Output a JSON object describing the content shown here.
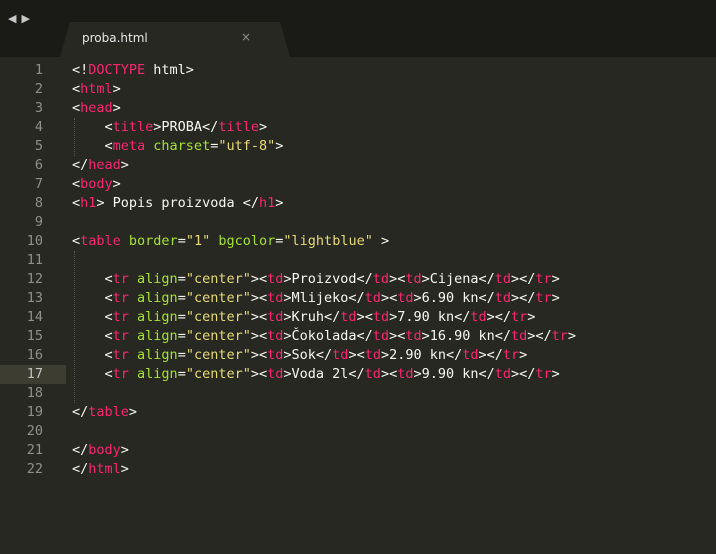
{
  "tabbar": {
    "nav_back": "◀",
    "nav_forward": "▶",
    "tab_title": "proba.html",
    "tab_close": "×"
  },
  "editor": {
    "active_line": 17,
    "lines": [
      {
        "n": "1",
        "segments": [
          {
            "t": "<!",
            "c": "punct"
          },
          {
            "t": "DOCTYPE",
            "c": "tag"
          },
          {
            "t": " html>",
            "c": "punct"
          }
        ]
      },
      {
        "n": "2",
        "segments": [
          {
            "t": "<",
            "c": "punct"
          },
          {
            "t": "html",
            "c": "tag"
          },
          {
            "t": ">",
            "c": "punct"
          }
        ]
      },
      {
        "n": "3",
        "segments": [
          {
            "t": "<",
            "c": "punct"
          },
          {
            "t": "head",
            "c": "tag"
          },
          {
            "t": ">",
            "c": "punct"
          }
        ]
      },
      {
        "n": "4",
        "segments": [
          {
            "t": "    <",
            "c": "punct"
          },
          {
            "t": "title",
            "c": "tag"
          },
          {
            "t": ">PROBA</",
            "c": "punct"
          },
          {
            "t": "title",
            "c": "tag"
          },
          {
            "t": ">",
            "c": "punct"
          }
        ]
      },
      {
        "n": "5",
        "segments": [
          {
            "t": "    <",
            "c": "punct"
          },
          {
            "t": "meta",
            "c": "tag"
          },
          {
            "t": " ",
            "c": "punct"
          },
          {
            "t": "charset",
            "c": "attr"
          },
          {
            "t": "=",
            "c": "punct"
          },
          {
            "t": "\"utf-8\"",
            "c": "str"
          },
          {
            "t": ">",
            "c": "punct"
          }
        ]
      },
      {
        "n": "6",
        "segments": [
          {
            "t": "</",
            "c": "punct"
          },
          {
            "t": "head",
            "c": "tag"
          },
          {
            "t": ">",
            "c": "punct"
          }
        ]
      },
      {
        "n": "7",
        "segments": [
          {
            "t": "<",
            "c": "punct"
          },
          {
            "t": "body",
            "c": "tag"
          },
          {
            "t": ">",
            "c": "punct"
          }
        ]
      },
      {
        "n": "8",
        "segments": [
          {
            "t": "<",
            "c": "punct"
          },
          {
            "t": "h1",
            "c": "tag"
          },
          {
            "t": "> Popis proizvoda </",
            "c": "punct"
          },
          {
            "t": "h1",
            "c": "tag"
          },
          {
            "t": ">",
            "c": "punct"
          }
        ]
      },
      {
        "n": "9",
        "segments": []
      },
      {
        "n": "10",
        "segments": [
          {
            "t": "<",
            "c": "punct"
          },
          {
            "t": "table",
            "c": "tag"
          },
          {
            "t": " ",
            "c": "punct"
          },
          {
            "t": "border",
            "c": "attr"
          },
          {
            "t": "=",
            "c": "punct"
          },
          {
            "t": "\"1\"",
            "c": "str"
          },
          {
            "t": " ",
            "c": "punct"
          },
          {
            "t": "bgcolor",
            "c": "attr"
          },
          {
            "t": "=",
            "c": "punct"
          },
          {
            "t": "\"lightblue\"",
            "c": "str"
          },
          {
            "t": " >",
            "c": "punct"
          }
        ]
      },
      {
        "n": "11",
        "segments": []
      },
      {
        "n": "12",
        "segments": [
          {
            "t": "    <",
            "c": "punct"
          },
          {
            "t": "tr",
            "c": "tag"
          },
          {
            "t": " ",
            "c": "punct"
          },
          {
            "t": "align",
            "c": "attr"
          },
          {
            "t": "=",
            "c": "punct"
          },
          {
            "t": "\"center\"",
            "c": "str"
          },
          {
            "t": "><",
            "c": "punct"
          },
          {
            "t": "td",
            "c": "tag"
          },
          {
            "t": ">Proizvod</",
            "c": "punct"
          },
          {
            "t": "td",
            "c": "tag"
          },
          {
            "t": "><",
            "c": "punct"
          },
          {
            "t": "td",
            "c": "tag"
          },
          {
            "t": ">Cijena</",
            "c": "punct"
          },
          {
            "t": "td",
            "c": "tag"
          },
          {
            "t": "></",
            "c": "punct"
          },
          {
            "t": "tr",
            "c": "tag"
          },
          {
            "t": ">",
            "c": "punct"
          }
        ]
      },
      {
        "n": "13",
        "segments": [
          {
            "t": "    <",
            "c": "punct"
          },
          {
            "t": "tr",
            "c": "tag"
          },
          {
            "t": " ",
            "c": "punct"
          },
          {
            "t": "align",
            "c": "attr"
          },
          {
            "t": "=",
            "c": "punct"
          },
          {
            "t": "\"center\"",
            "c": "str"
          },
          {
            "t": "><",
            "c": "punct"
          },
          {
            "t": "td",
            "c": "tag"
          },
          {
            "t": ">Mlijeko</",
            "c": "punct"
          },
          {
            "t": "td",
            "c": "tag"
          },
          {
            "t": "><",
            "c": "punct"
          },
          {
            "t": "td",
            "c": "tag"
          },
          {
            "t": ">6.90 kn</",
            "c": "punct"
          },
          {
            "t": "td",
            "c": "tag"
          },
          {
            "t": "></",
            "c": "punct"
          },
          {
            "t": "tr",
            "c": "tag"
          },
          {
            "t": ">",
            "c": "punct"
          }
        ]
      },
      {
        "n": "14",
        "segments": [
          {
            "t": "    <",
            "c": "punct"
          },
          {
            "t": "tr",
            "c": "tag"
          },
          {
            "t": " ",
            "c": "punct"
          },
          {
            "t": "align",
            "c": "attr"
          },
          {
            "t": "=",
            "c": "punct"
          },
          {
            "t": "\"center\"",
            "c": "str"
          },
          {
            "t": "><",
            "c": "punct"
          },
          {
            "t": "td",
            "c": "tag"
          },
          {
            "t": ">Kruh</",
            "c": "punct"
          },
          {
            "t": "td",
            "c": "tag"
          },
          {
            "t": "><",
            "c": "punct"
          },
          {
            "t": "td",
            "c": "tag"
          },
          {
            "t": ">7.90 kn</",
            "c": "punct"
          },
          {
            "t": "td",
            "c": "tag"
          },
          {
            "t": "></",
            "c": "punct"
          },
          {
            "t": "tr",
            "c": "tag"
          },
          {
            "t": ">",
            "c": "punct"
          }
        ]
      },
      {
        "n": "15",
        "segments": [
          {
            "t": "    <",
            "c": "punct"
          },
          {
            "t": "tr",
            "c": "tag"
          },
          {
            "t": " ",
            "c": "punct"
          },
          {
            "t": "align",
            "c": "attr"
          },
          {
            "t": "=",
            "c": "punct"
          },
          {
            "t": "\"center\"",
            "c": "str"
          },
          {
            "t": "><",
            "c": "punct"
          },
          {
            "t": "td",
            "c": "tag"
          },
          {
            "t": ">Čokolada</",
            "c": "punct"
          },
          {
            "t": "td",
            "c": "tag"
          },
          {
            "t": "><",
            "c": "punct"
          },
          {
            "t": "td",
            "c": "tag"
          },
          {
            "t": ">16.90 kn</",
            "c": "punct"
          },
          {
            "t": "td",
            "c": "tag"
          },
          {
            "t": "></",
            "c": "punct"
          },
          {
            "t": "tr",
            "c": "tag"
          },
          {
            "t": ">",
            "c": "punct"
          }
        ]
      },
      {
        "n": "16",
        "segments": [
          {
            "t": "    <",
            "c": "punct"
          },
          {
            "t": "tr",
            "c": "tag"
          },
          {
            "t": " ",
            "c": "punct"
          },
          {
            "t": "align",
            "c": "attr"
          },
          {
            "t": "=",
            "c": "punct"
          },
          {
            "t": "\"center\"",
            "c": "str"
          },
          {
            "t": "><",
            "c": "punct"
          },
          {
            "t": "td",
            "c": "tag"
          },
          {
            "t": ">Sok</",
            "c": "punct"
          },
          {
            "t": "td",
            "c": "tag"
          },
          {
            "t": "><",
            "c": "punct"
          },
          {
            "t": "td",
            "c": "tag"
          },
          {
            "t": ">2.90 kn</",
            "c": "punct"
          },
          {
            "t": "td",
            "c": "tag"
          },
          {
            "t": "></",
            "c": "punct"
          },
          {
            "t": "tr",
            "c": "tag"
          },
          {
            "t": ">",
            "c": "punct"
          }
        ]
      },
      {
        "n": "17",
        "segments": [
          {
            "t": "    <",
            "c": "punct"
          },
          {
            "t": "tr",
            "c": "tag"
          },
          {
            "t": " ",
            "c": "punct"
          },
          {
            "t": "align",
            "c": "attr"
          },
          {
            "t": "=",
            "c": "punct"
          },
          {
            "t": "\"center\"",
            "c": "str"
          },
          {
            "t": "><",
            "c": "punct"
          },
          {
            "t": "td",
            "c": "tag"
          },
          {
            "t": ">Voda 2l</",
            "c": "punct"
          },
          {
            "t": "td",
            "c": "tag"
          },
          {
            "t": "><",
            "c": "punct"
          },
          {
            "t": "td",
            "c": "tag"
          },
          {
            "t": ">9.90 kn</",
            "c": "punct"
          },
          {
            "t": "td",
            "c": "tag"
          },
          {
            "t": "></",
            "c": "punct"
          },
          {
            "t": "tr",
            "c": "tag"
          },
          {
            "t": ">",
            "c": "punct"
          }
        ]
      },
      {
        "n": "18",
        "segments": []
      },
      {
        "n": "19",
        "segments": [
          {
            "t": "</",
            "c": "punct"
          },
          {
            "t": "table",
            "c": "tag"
          },
          {
            "t": ">",
            "c": "punct"
          }
        ]
      },
      {
        "n": "20",
        "segments": []
      },
      {
        "n": "21",
        "segments": [
          {
            "t": "</",
            "c": "punct"
          },
          {
            "t": "body",
            "c": "tag"
          },
          {
            "t": ">",
            "c": "punct"
          }
        ]
      },
      {
        "n": "22",
        "segments": [
          {
            "t": "</",
            "c": "punct"
          },
          {
            "t": "html",
            "c": "tag"
          },
          {
            "t": ">",
            "c": "punct"
          }
        ]
      }
    ]
  }
}
